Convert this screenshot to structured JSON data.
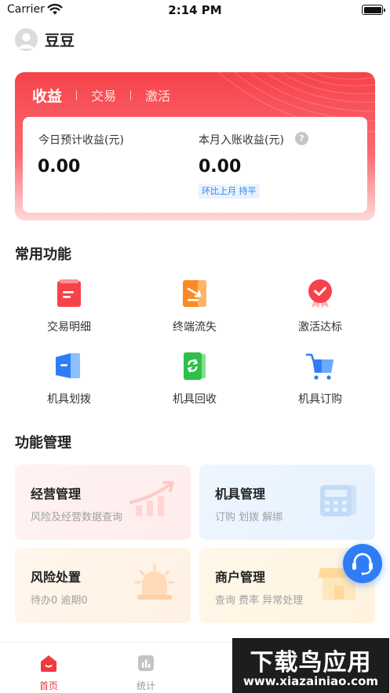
{
  "status_bar": {
    "carrier": "Carrier",
    "time": "2:14 PM"
  },
  "user": {
    "name": "豆豆"
  },
  "earnings": {
    "tabs": [
      {
        "label": "收益",
        "active": true
      },
      {
        "label": "交易",
        "active": false
      },
      {
        "label": "激活",
        "active": false
      }
    ],
    "today_label": "今日预计收益(元)",
    "today_value": "0.00",
    "month_label": "本月入账收益(元)",
    "month_value": "0.00",
    "help_glyph": "?",
    "compare_text": "环比上月 持平"
  },
  "common_functions": {
    "title": "常用功能",
    "items": [
      {
        "label": "交易明细",
        "icon": "transaction-detail-icon"
      },
      {
        "label": "终端流失",
        "icon": "terminal-loss-icon"
      },
      {
        "label": "激活达标",
        "icon": "activation-target-icon"
      },
      {
        "label": "机具划拨",
        "icon": "device-transfer-icon"
      },
      {
        "label": "机具回收",
        "icon": "device-recycle-icon"
      },
      {
        "label": "机具订购",
        "icon": "device-order-cart-icon"
      }
    ]
  },
  "management": {
    "title": "功能管理",
    "cards": [
      {
        "title": "经营管理",
        "subtitle": "风险及经营数据查询"
      },
      {
        "title": "机具管理",
        "subtitle": "订购 划拨 解绑"
      },
      {
        "title": "风险处置",
        "subtitle": "待办0   逾期0"
      },
      {
        "title": "商户管理",
        "subtitle": "查询 费率 异常处理"
      }
    ]
  },
  "tabbar": {
    "items": [
      {
        "label": "首页",
        "active": true
      },
      {
        "label": "统计",
        "active": false
      }
    ]
  },
  "watermark": {
    "title": "下载鸟应用",
    "url": "www.xiazainiao.com"
  },
  "colors": {
    "brand_red": "#f6424a",
    "accent_blue": "#2f7df6"
  }
}
